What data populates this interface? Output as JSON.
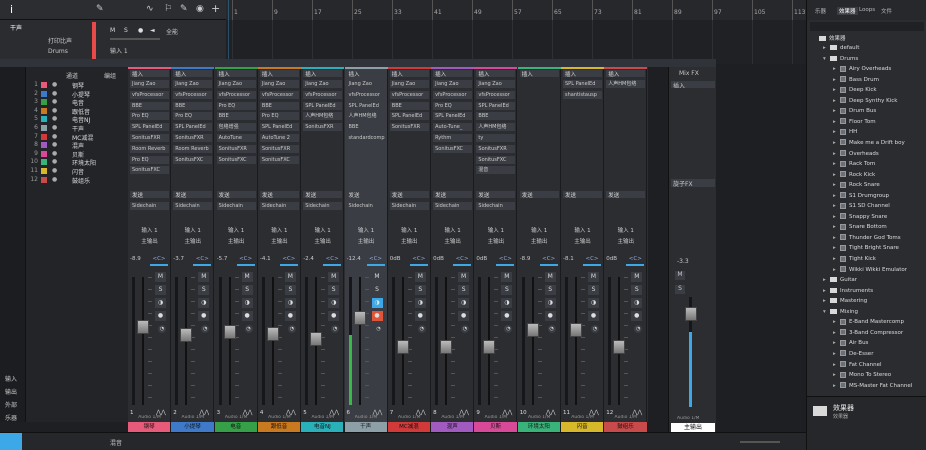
{
  "ruler": [
    "1",
    "9",
    "17",
    "25",
    "33",
    "41",
    "49",
    "57",
    "65",
    "73",
    "81",
    "89",
    "97",
    "105",
    "113"
  ],
  "track": {
    "name": "干声",
    "input_label": "打印比声",
    "preset": "Drums",
    "insert": "输入 1",
    "tool": "全能"
  },
  "left_list": {
    "headers": [
      "通道",
      "编组"
    ],
    "channels": [
      {
        "num": "1",
        "name": "钢琴",
        "color": "#e85a7a"
      },
      {
        "num": "2",
        "name": "小提琴",
        "color": "#3e7ac9"
      },
      {
        "num": "3",
        "name": "电音",
        "color": "#35a048"
      },
      {
        "num": "4",
        "name": "跟低音",
        "color": "#c97a20"
      },
      {
        "num": "5",
        "name": "电音NJ",
        "color": "#2ab0b8"
      },
      {
        "num": "6",
        "name": "干声",
        "color": "#8da0a8"
      },
      {
        "num": "7",
        "name": "MC减混",
        "color": "#d23a3a"
      },
      {
        "num": "8",
        "name": "混声",
        "color": "#a05ac0"
      },
      {
        "num": "9",
        "name": "贝斯",
        "color": "#d84a98"
      },
      {
        "num": "10",
        "name": "环境太阳",
        "color": "#3ab37a"
      },
      {
        "num": "11",
        "name": "闪音",
        "color": "#d6b82a"
      },
      {
        "num": "12",
        "name": "鼓组乐",
        "color": "#c84a4a"
      }
    ],
    "side_labels": [
      "输入",
      "输出",
      "外部",
      "乐器"
    ]
  },
  "mixer": {
    "insert_label": "插入",
    "send_label": "发送",
    "input_route": "输入 1",
    "output_route": "主输出",
    "mute": "M",
    "solo": "S",
    "out_label": "Audio 1/M",
    "strips": [
      {
        "name": "钢琴",
        "num": "1",
        "vol": "-8.9",
        "pan": "<C>",
        "color": "#e85a7a",
        "fader": 0.62,
        "plugins": [
          "Jiang Zao",
          "vfsProcessor",
          "BBE",
          "Pro EQ",
          "SPL PanelEd",
          "SonitusFXR",
          "Room Reverb",
          "Pro EQ",
          "SonitusFXC"
        ],
        "send": "Sidechain"
      },
      {
        "name": "小提琴",
        "num": "2",
        "vol": "-3.7",
        "pan": "<C>",
        "color": "#3e7ac9",
        "fader": 0.55,
        "plugins": [
          "Jiang Zao",
          "vfsProcessor",
          "BBE",
          "Pro EQ",
          "SPL PanelEd",
          "SonitusFXR",
          "Room Reverb",
          "SonitusFXC"
        ],
        "send": "Sidechain"
      },
      {
        "name": "电音",
        "num": "3",
        "vol": "-5.7",
        "pan": "<C>",
        "color": "#35a048",
        "fader": 0.58,
        "plugins": [
          "Jiang Zao",
          "vfsProcessor",
          "Pro EQ",
          "BBE",
          "包络增强",
          "AutoTune",
          "SonitusFXR",
          "SonitusFXC"
        ],
        "send": "Sidechain"
      },
      {
        "name": "跟低音",
        "num": "4",
        "vol": "-4.1",
        "pan": "<C>",
        "color": "#c97a20",
        "fader": 0.56,
        "plugins": [
          "Jiang Zao",
          "vfsProcessor",
          "BBE",
          "Pro EQ",
          "SPL PanelEd",
          "AutoTune 2",
          "SonitusFXR",
          "SonitusFXC"
        ],
        "send": "Sidechain"
      },
      {
        "name": "电音NJ",
        "num": "5",
        "vol": "-2.4",
        "pan": "<C>",
        "color": "#2ab0b8",
        "fader": 0.52,
        "plugins": [
          "Jiang Zao",
          "vfsProcessor",
          "SPL PanelEd",
          "人声HM包络",
          "SonitusFXR"
        ],
        "send": "Sidechain"
      },
      {
        "name": "干声",
        "num": "6",
        "vol": "-12.4",
        "pan": "<C>",
        "color": "#8da0a8",
        "fader": 0.7,
        "plugins": [
          "Jiang Zao",
          "vfsProcessor",
          "SPL PanelEd",
          "人声HM包络",
          "BBE",
          "standardcomp"
        ],
        "send": "Sidechain"
      },
      {
        "name": "MC减混",
        "num": "7",
        "vol": "0dB",
        "pan": "<C>",
        "color": "#d23a3a",
        "fader": 0.45,
        "plugins": [
          "Jiang Zao",
          "vfsProcessor",
          "BBE",
          "SPL PanelEd",
          "SonitusFXR"
        ],
        "send": "Sidechain"
      },
      {
        "name": "混声",
        "num": "8",
        "vol": "0dB",
        "pan": "<C>",
        "color": "#a05ac0",
        "fader": 0.45,
        "plugins": [
          "Jiang Zao",
          "vfsProcessor",
          "Pro EQ",
          "SPL PanelEd",
          "Auto-Tune_",
          "Rythm",
          "SonitusFXC"
        ],
        "send": "Sidechain"
      },
      {
        "name": "贝斯",
        "num": "9",
        "vol": "0dB",
        "pan": "<C>",
        "color": "#d84a98",
        "fader": 0.45,
        "plugins": [
          "Jiang Zao",
          "vfsProcessor",
          "SPL PanelEd",
          "BBE",
          "人声HM包络",
          "ty",
          "SonitusFXR",
          "SonitusFXC",
          "混音"
        ],
        "send": "Sidechain"
      },
      {
        "name": "环境太阳",
        "num": "10",
        "vol": "-8.9",
        "pan": "<C>",
        "color": "#3ab37a",
        "fader": 0.6,
        "plugins": [],
        "send": ""
      },
      {
        "name": "闪音",
        "num": "11",
        "vol": "-8.1",
        "pan": "<C>",
        "color": "#d6b82a",
        "fader": 0.6,
        "plugins": [
          "SPL PanelEd",
          "shantistausp"
        ],
        "send": ""
      },
      {
        "name": "鼓组乐",
        "num": "12",
        "vol": "0dB",
        "pan": "<C>",
        "color": "#c84a4a",
        "fader": 0.45,
        "plugins": [
          "人声HM包络"
        ],
        "send": ""
      }
    ]
  },
  "mainout": {
    "title": "Mix FX",
    "insert_label": "插入",
    "side": "旋子FX",
    "vol": "-3.3",
    "label": "主输出",
    "out": "Audio 1/M"
  },
  "browser": {
    "tabs": [
      "乐器",
      "效果器",
      "Loops",
      "文件"
    ],
    "root": "效果器",
    "items": [
      {
        "label": "default",
        "type": "folder",
        "level": 1
      },
      {
        "label": "Drums",
        "type": "folder",
        "level": 1,
        "open": true
      },
      {
        "label": "Airy Overheads",
        "type": "preset",
        "level": 2
      },
      {
        "label": "Bass Drum",
        "type": "preset",
        "level": 2
      },
      {
        "label": "Deep Kick",
        "type": "preset",
        "level": 2
      },
      {
        "label": "Deep Synthy Kick",
        "type": "preset",
        "level": 2
      },
      {
        "label": "Drum Bus",
        "type": "preset",
        "level": 2
      },
      {
        "label": "Floor Tom",
        "type": "preset",
        "level": 2
      },
      {
        "label": "HH",
        "type": "preset",
        "level": 2
      },
      {
        "label": "Make me a Drift boy",
        "type": "preset",
        "level": 2
      },
      {
        "label": "Overheads",
        "type": "preset",
        "level": 2
      },
      {
        "label": "Rack Tom",
        "type": "preset",
        "level": 2
      },
      {
        "label": "Rock Kick",
        "type": "preset",
        "level": 2
      },
      {
        "label": "Rock Snare",
        "type": "preset",
        "level": 2
      },
      {
        "label": "S1 Drumgroup",
        "type": "preset",
        "level": 2
      },
      {
        "label": "S1 SD Channel",
        "type": "preset",
        "level": 2
      },
      {
        "label": "Snappy Snare",
        "type": "preset",
        "level": 2
      },
      {
        "label": "Snare Bottom",
        "type": "preset",
        "level": 2
      },
      {
        "label": "Thunder God Toms",
        "type": "preset",
        "level": 2
      },
      {
        "label": "Tight Bright Snare",
        "type": "preset",
        "level": 2
      },
      {
        "label": "Tight Kick",
        "type": "preset",
        "level": 2
      },
      {
        "label": "Wikki Wikki Emulator",
        "type": "preset",
        "level": 2
      },
      {
        "label": "Guitar",
        "type": "folder",
        "level": 1
      },
      {
        "label": "Instruments",
        "type": "folder",
        "level": 1
      },
      {
        "label": "Mastering",
        "type": "folder",
        "level": 1
      },
      {
        "label": "Mixing",
        "type": "folder",
        "level": 1,
        "open": true
      },
      {
        "label": "E-Band Mastercomp",
        "type": "preset",
        "level": 2
      },
      {
        "label": "3-Band Compressor",
        "type": "preset",
        "level": 2
      },
      {
        "label": "Air Bus",
        "type": "preset",
        "level": 2
      },
      {
        "label": "De-Esser",
        "type": "preset",
        "level": 2
      },
      {
        "label": "Fat Channel",
        "type": "preset",
        "level": 2
      },
      {
        "label": "Mono To Stereo",
        "type": "preset",
        "level": 2
      },
      {
        "label": "MS-Master Fat Channel",
        "type": "preset",
        "level": 2
      }
    ],
    "footer_title": "效果器",
    "footer_sub": "效果器"
  },
  "bottom": {
    "label": "混音"
  }
}
